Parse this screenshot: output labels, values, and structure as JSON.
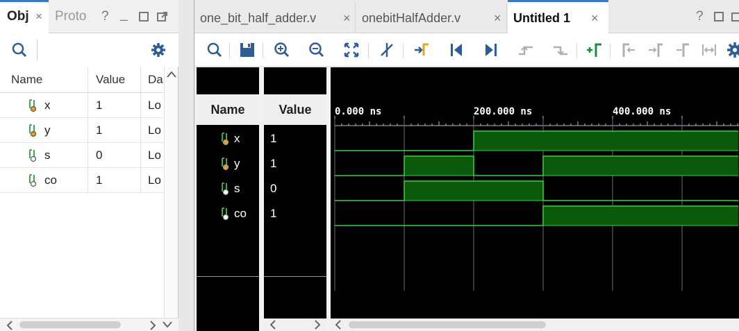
{
  "left_panel": {
    "tabs": [
      {
        "label": "Obj",
        "active": true
      },
      {
        "label": "Proto",
        "active": false
      }
    ],
    "columns": [
      "Name",
      "Value",
      "Da"
    ],
    "rows": [
      {
        "name": "x",
        "value": "1",
        "type": "Lo"
      },
      {
        "name": "y",
        "value": "1",
        "type": "Lo"
      },
      {
        "name": "s",
        "value": "0",
        "type": "Lo"
      },
      {
        "name": "co",
        "value": "1",
        "type": "Lo"
      }
    ]
  },
  "right_panel": {
    "tabs": [
      {
        "label": "one_bit_half_adder.v",
        "active": false
      },
      {
        "label": "onebitHalfAdder.v",
        "active": false
      },
      {
        "label": "Untitled 1",
        "active": true
      }
    ],
    "toolbar_icons": [
      "search-icon",
      "save-icon",
      "zoom-in-icon",
      "zoom-out-icon",
      "zoom-fit-icon",
      "cursor-snap-icon",
      "go-to-cursor-icon",
      "go-to-start-icon",
      "go-to-end-icon",
      "prev-transition-icon",
      "next-transition-icon",
      "add-marker-icon",
      "prev-marker-icon",
      "next-marker-icon",
      "marker-icon",
      "swap-cursors-icon",
      "settings-icon"
    ],
    "wave": {
      "name_header": "Name",
      "value_header": "Value",
      "time_labels": [
        "0.000 ns",
        "200.000 ns",
        "400.000 ns"
      ],
      "time_unit_ns_per_division": 100,
      "signals": [
        {
          "name": "x",
          "value": "1",
          "waveform": [
            0,
            0,
            1,
            1,
            1,
            1
          ]
        },
        {
          "name": "y",
          "value": "1",
          "waveform": [
            0,
            1,
            0,
            1,
            1,
            1
          ]
        },
        {
          "name": "s",
          "value": "0",
          "waveform": [
            0,
            1,
            1,
            0,
            0,
            0
          ]
        },
        {
          "name": "co",
          "value": "1",
          "waveform": [
            0,
            0,
            0,
            1,
            1,
            1
          ]
        }
      ],
      "colors": {
        "wave_fill": "#0b5a0b",
        "wave_line": "#39d139",
        "grid": "#6e6e6e",
        "background": "#000000"
      }
    }
  },
  "glyphs": {
    "close": "×",
    "help": "?",
    "minimize": "_",
    "chev_left": "‹",
    "chev_right": "›"
  }
}
